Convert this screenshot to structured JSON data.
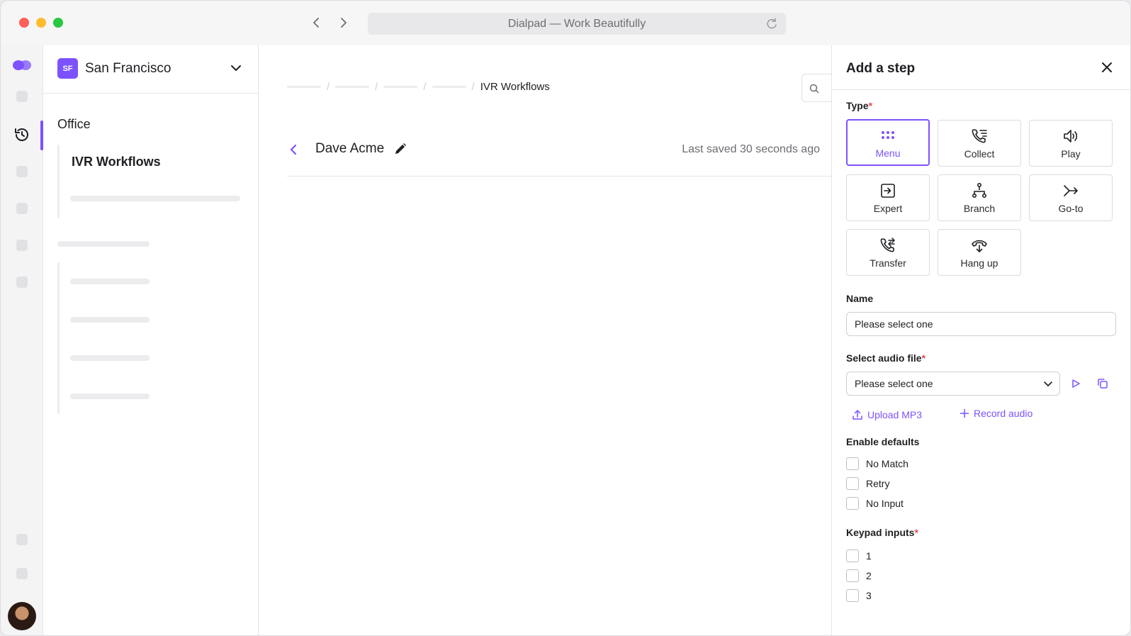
{
  "browser": {
    "url_title": "Dialpad — Work Beautifully"
  },
  "sidebar": {
    "org_badge": "SF",
    "org_name": "San Francisco",
    "section": "Office",
    "active_item": "IVR Workflows"
  },
  "main": {
    "breadcrumb_current": "IVR Workflows",
    "workflow_name": "Dave Acme",
    "saved_status": "Last saved 30 seconds ago"
  },
  "panel": {
    "title": "Add a step",
    "type_label": "Type",
    "required_mark": "*",
    "types": [
      {
        "label": "Menu",
        "icon": "dots-grid-icon",
        "selected": true
      },
      {
        "label": "Collect",
        "icon": "phone-list-icon",
        "selected": false
      },
      {
        "label": "Play",
        "icon": "speaker-icon",
        "selected": false
      },
      {
        "label": "Expert",
        "icon": "expert-box-icon",
        "selected": false
      },
      {
        "label": "Branch",
        "icon": "branch-icon",
        "selected": false
      },
      {
        "label": "Go-to",
        "icon": "goto-arrow-icon",
        "selected": false
      },
      {
        "label": "Transfer",
        "icon": "phone-transfer-icon",
        "selected": false
      },
      {
        "label": "Hang up",
        "icon": "hang-up-icon",
        "selected": false
      }
    ],
    "name_label": "Name",
    "name_placeholder": "Please select one",
    "audio_label": "Select audio file",
    "audio_placeholder": "Please select one",
    "upload_label": "Upload MP3",
    "record_label": "Record audio",
    "defaults_label": "Enable defaults",
    "defaults": [
      "No Match",
      "Retry",
      "No Input"
    ],
    "keypad_label": "Keypad inputs",
    "keypad": [
      "1",
      "2",
      "3"
    ]
  },
  "colors": {
    "accent": "#7c52ff",
    "required": "#e5484d"
  }
}
